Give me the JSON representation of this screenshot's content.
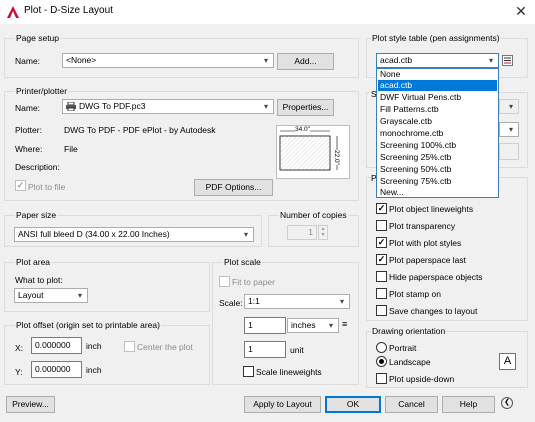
{
  "window": {
    "title": "Plot - D-Size Layout",
    "close_glyph": "✕"
  },
  "page_setup": {
    "group": "Page setup",
    "name_label": "Name:",
    "name_value": "<None>",
    "add_button": "Add..."
  },
  "printer": {
    "group": "Printer/plotter",
    "name_label": "Name:",
    "name_value": "DWG To PDF.pc3",
    "properties_button": "Properties...",
    "plotter_label": "Plotter:",
    "plotter_value": "DWG To PDF - PDF ePlot - by Autodesk",
    "where_label": "Where:",
    "where_value": "File",
    "description_label": "Description:",
    "plot_to_file": "Plot to file",
    "pdf_options_button": "PDF Options...",
    "preview_width": "34.0\"",
    "preview_height": "22.0\""
  },
  "paper_size": {
    "group": "Paper size",
    "value": "ANSI full bleed D (34.00 x 22.00 Inches)"
  },
  "copies": {
    "group": "Number of copies",
    "value": "1"
  },
  "plot_area": {
    "group": "Plot area",
    "what_label": "What to plot:",
    "what_value": "Layout"
  },
  "plot_scale": {
    "group": "Plot scale",
    "fit_to_paper": "Fit to paper",
    "scale_label": "Scale:",
    "scale_value": "1:1",
    "inches_value": "1",
    "units_value": "inches",
    "unit_value": "1",
    "unit_label": "unit",
    "scale_lineweights": "Scale lineweights"
  },
  "plot_offset": {
    "group": "Plot offset (origin set to printable area)",
    "x_label": "X:",
    "x_value": "0.000000",
    "x_unit": "inch",
    "y_label": "Y:",
    "y_value": "0.000000",
    "y_unit": "inch",
    "center_plot": "Center the plot"
  },
  "plot_style": {
    "group": "Plot style table (pen assignments)",
    "value": "acad.ctb",
    "options": [
      "None",
      "acad.ctb",
      "DWF Virtual Pens.ctb",
      "Fill Patterns.ctb",
      "Grayscale.ctb",
      "monochrome.ctb",
      "Screening 100%.ctb",
      "Screening 25%.ctb",
      "Screening 50%.ctb",
      "Screening 75%.ctb",
      "New..."
    ],
    "highlighted_index": 1
  },
  "plot_options": {
    "items": [
      {
        "label": "Plot object lineweights",
        "checked": true
      },
      {
        "label": "Plot transparency",
        "checked": false
      },
      {
        "label": "Plot with plot styles",
        "checked": true
      },
      {
        "label": "Plot paperspace last",
        "checked": true
      },
      {
        "label": "Hide paperspace objects",
        "checked": false
      },
      {
        "label": "Plot stamp on",
        "checked": false
      },
      {
        "label": "Save changes to layout",
        "checked": false
      }
    ]
  },
  "orientation": {
    "group": "Drawing orientation",
    "portrait": "Portrait",
    "landscape": "Landscape",
    "upside_down": "Plot upside-down",
    "selected": "Landscape",
    "icon_letter": "A"
  },
  "footer": {
    "preview_button": "Preview...",
    "apply_button": "Apply to Layout",
    "ok_button": "OK",
    "cancel_button": "Cancel",
    "help_button": "Help"
  },
  "colors": {
    "accent": "#0078d7",
    "app_icon": "#c8102e"
  }
}
